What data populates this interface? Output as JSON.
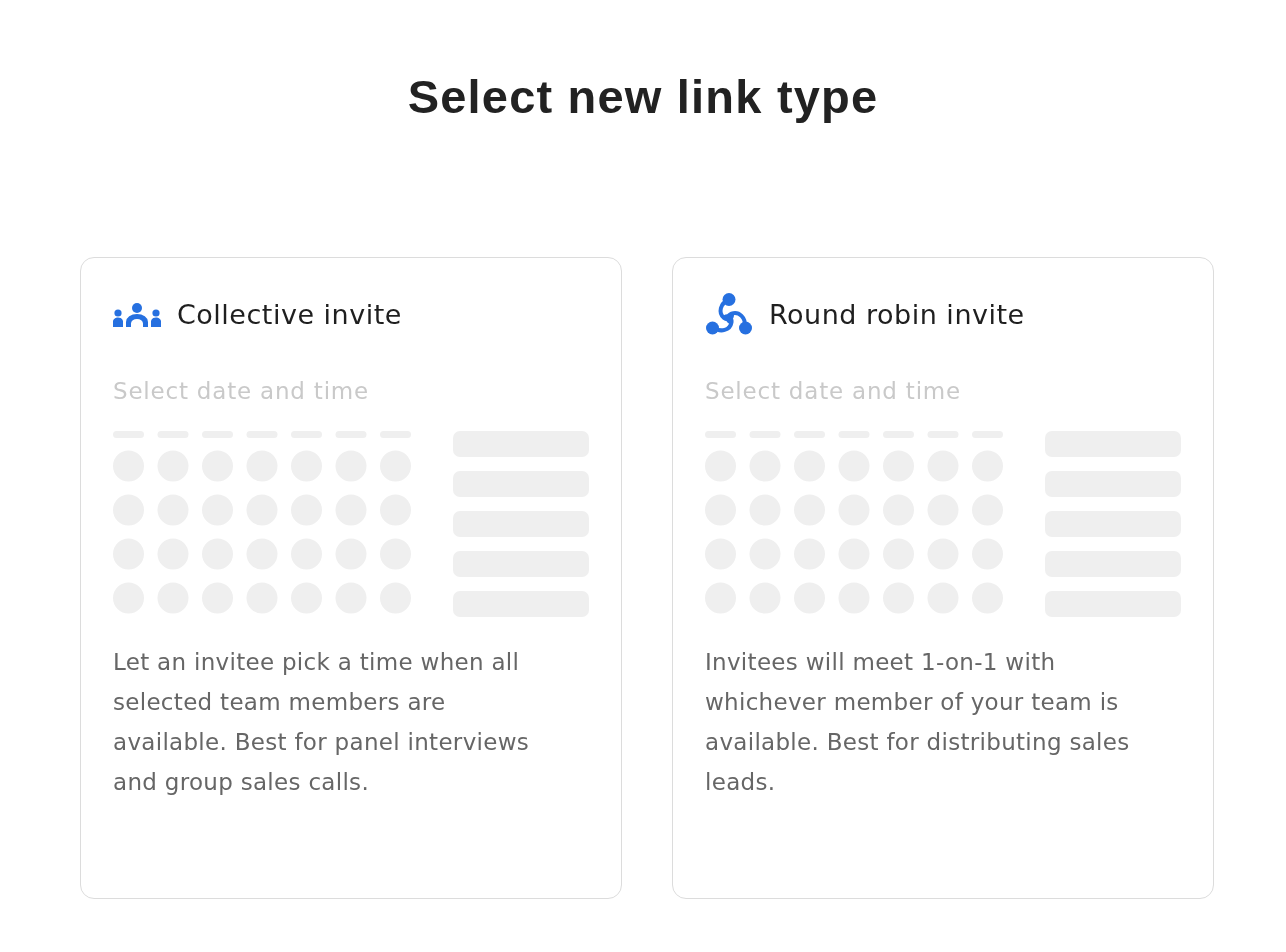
{
  "title": "Select new link type",
  "cards": [
    {
      "kind": "collective",
      "title": "Collective invite",
      "preview_heading": "Select date and time",
      "description_lines": [
        "Let an invitee pick a time when all",
        "selected team members are",
        "available. Best for panel interviews",
        "and group sales calls."
      ]
    },
    {
      "kind": "round_robin",
      "title": "Round robin invite",
      "preview_heading": "Select date and time",
      "description_lines": [
        "Invitees will meet 1-on-1 with",
        "whichever member of your team is",
        "available. Best for distributing sales",
        "leads."
      ]
    }
  ]
}
